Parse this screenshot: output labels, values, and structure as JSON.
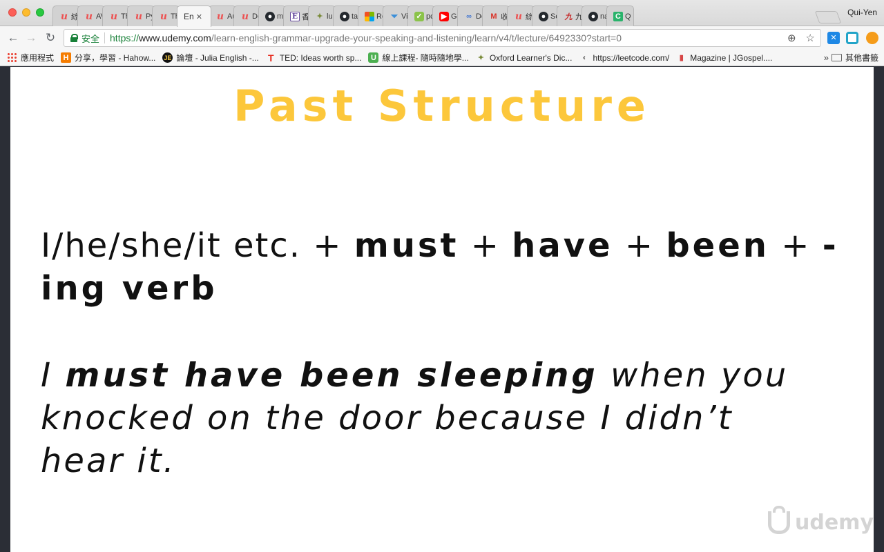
{
  "window": {
    "user_name": "Qui-Yen"
  },
  "tabs": [
    {
      "label": "綜",
      "icon": "udemy-icon",
      "active": false
    },
    {
      "label": "AV",
      "icon": "udemy-icon",
      "active": false
    },
    {
      "label": "Th",
      "icon": "udemy-icon",
      "active": false
    },
    {
      "label": "Py",
      "icon": "udemy-icon",
      "active": false
    },
    {
      "label": "Th",
      "icon": "udemy-icon",
      "active": false
    },
    {
      "label": "En",
      "icon": "none",
      "active": true,
      "close": "✕"
    },
    {
      "label": "Au",
      "icon": "udemy-icon",
      "active": false
    },
    {
      "label": "De",
      "icon": "udemy-icon",
      "active": false
    },
    {
      "label": "m",
      "icon": "github-icon",
      "active": false
    },
    {
      "label": "香",
      "icon": "e-icon",
      "active": false
    },
    {
      "label": "lu",
      "icon": "map-icon",
      "active": false
    },
    {
      "label": "ta",
      "icon": "github-icon",
      "active": false
    },
    {
      "label": "Re",
      "icon": "microsoft-icon",
      "active": false
    },
    {
      "label": "Vi",
      "icon": "funnel-icon",
      "active": false
    },
    {
      "label": "pc",
      "icon": "check-icon",
      "active": false
    },
    {
      "label": "G",
      "icon": "youtube-icon",
      "active": false
    },
    {
      "label": "Dc",
      "icon": "link-icon",
      "active": false
    },
    {
      "label": "收",
      "icon": "gmail-icon",
      "active": false
    },
    {
      "label": "綜",
      "icon": "udemy-icon",
      "active": false
    },
    {
      "label": "Sc",
      "icon": "github-icon",
      "active": false
    },
    {
      "label": "九",
      "icon": "nine-icon",
      "active": false
    },
    {
      "label": "na",
      "icon": "github-icon",
      "active": false
    },
    {
      "label": "Q",
      "icon": "c-icon",
      "active": false
    }
  ],
  "toolbar": {
    "secure_label": "安全",
    "url_scheme": "https://",
    "url_host": "www.udemy.com",
    "url_path": "/learn-english-grammar-upgrade-your-speaking-and-listening/learn/v4/t/lecture/6492330?start=0"
  },
  "bookmarks": {
    "items": [
      {
        "label": "應用程式",
        "icon": "apps-icon"
      },
      {
        "label": "分享，學習 - Hahow...",
        "icon": "hahow-icon"
      },
      {
        "label": "論壇 - Julia English -...",
        "icon": "julia-icon"
      },
      {
        "label": "TED: Ideas worth sp...",
        "icon": "ted-icon"
      },
      {
        "label": "線上課程- 隨時隨地學...",
        "icon": "u-icon"
      },
      {
        "label": "Oxford Learner's Dic...",
        "icon": "oxford-icon"
      },
      {
        "label": "https://leetcode.com/",
        "icon": "leetcode-icon"
      },
      {
        "label": "Magazine | JGospel....",
        "icon": "magazine-icon"
      }
    ],
    "more": "»",
    "folder_label": "其他書籤"
  },
  "slide": {
    "title": "Past Structure",
    "structure_plain": "I/he/she/it etc. + ",
    "structure_must": "must",
    "sep1": " + ",
    "structure_have": "have",
    "sep2": " + ",
    "structure_been": "been",
    "sep3": " + ",
    "structure_verb": "-ing verb",
    "example_start": "I ",
    "example_bold": "must have been sleeping",
    "example_rest": " when you knocked on the door because I didn’t hear it.",
    "watermark": "udemy"
  }
}
